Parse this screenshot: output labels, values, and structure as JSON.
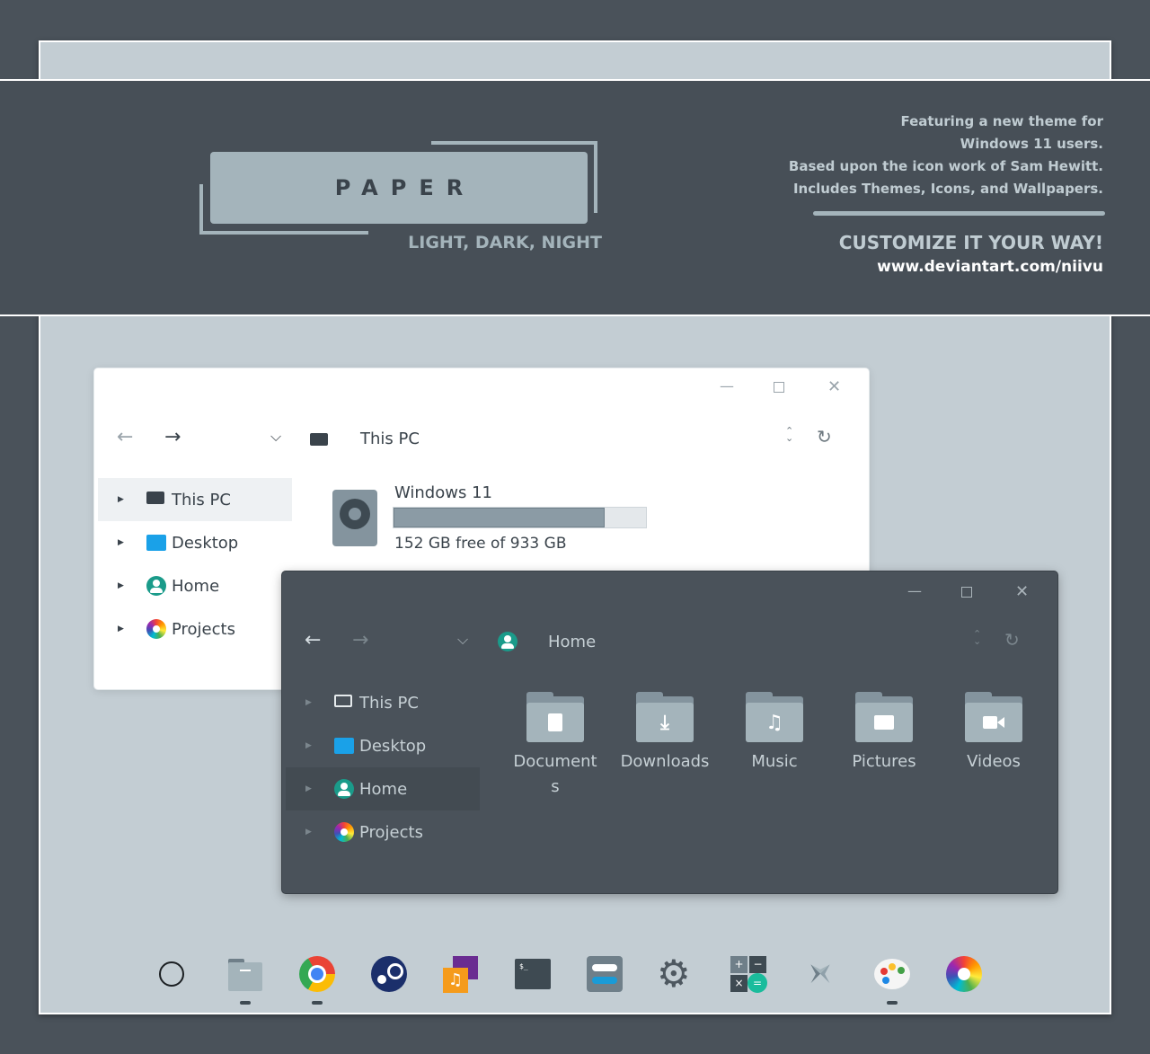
{
  "banner": {
    "logo": "PAPER",
    "variants": "LIGHT, DARK, NIGHT",
    "blurb": [
      "Featuring a new theme for",
      "Windows 11 users.",
      "Based upon the icon work of Sam Hewitt.",
      "Includes Themes, Icons, and Wallpapers."
    ],
    "tagline": "CUSTOMIZE IT YOUR WAY!",
    "url": "www.deviantart.com/niivu"
  },
  "light_window": {
    "location": "This PC",
    "sidebar": [
      {
        "label": "This PC",
        "icon": "monitor-icon",
        "selected": true
      },
      {
        "label": "Desktop",
        "icon": "desktop-folder-icon",
        "selected": false
      },
      {
        "label": "Home",
        "icon": "home-user-icon",
        "selected": false
      },
      {
        "label": "Projects",
        "icon": "color-wheel-icon",
        "selected": false
      }
    ],
    "drive": {
      "name": "Windows 11",
      "status": "152 GB free of 933 GB",
      "used_fraction": 0.837
    }
  },
  "dark_window": {
    "location": "Home",
    "sidebar": [
      {
        "label": "This PC",
        "icon": "monitor-icon",
        "selected": false
      },
      {
        "label": "Desktop",
        "icon": "desktop-folder-icon",
        "selected": false
      },
      {
        "label": "Home",
        "icon": "home-user-icon",
        "selected": true
      },
      {
        "label": "Projects",
        "icon": "color-wheel-icon",
        "selected": false
      }
    ],
    "folders": [
      {
        "label": "Documents",
        "icon": "document-icon"
      },
      {
        "label": "Downloads",
        "icon": "download-icon"
      },
      {
        "label": "Music",
        "icon": "music-note-icon"
      },
      {
        "label": "Pictures",
        "icon": "image-icon"
      },
      {
        "label": "Videos",
        "icon": "video-camera-icon"
      }
    ]
  },
  "dock": [
    {
      "name": "start-circle-icon",
      "running": false
    },
    {
      "name": "file-manager-icon",
      "running": true
    },
    {
      "name": "chrome-icon",
      "running": true
    },
    {
      "name": "steam-icon",
      "running": false
    },
    {
      "name": "media-player-icon",
      "running": false
    },
    {
      "name": "terminal-icon",
      "running": false
    },
    {
      "name": "toggle-settings-icon",
      "running": false
    },
    {
      "name": "settings-gear-icon",
      "running": false
    },
    {
      "name": "calculator-icon",
      "running": false
    },
    {
      "name": "pinwheel-icon",
      "running": false
    },
    {
      "name": "paint-palette-icon",
      "running": true
    },
    {
      "name": "color-wheel-icon",
      "running": false
    }
  ],
  "colors": {
    "background": "#4a525a",
    "canvas": "#c3cdd3",
    "banner": "#474f57",
    "accent": "#a4b4bb",
    "light_window": "#ffffff",
    "dark_window": "#4a525a"
  }
}
